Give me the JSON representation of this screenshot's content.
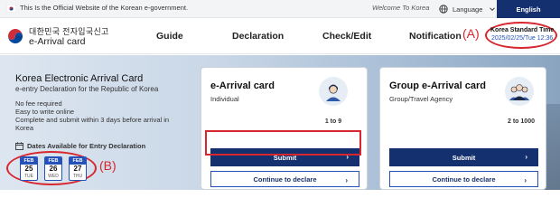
{
  "gov_bar": {
    "text": "This Is the Official Website of the Korean e-government.",
    "welcome": "Welcome To Korea",
    "language_label": "Language",
    "language_selected": "English"
  },
  "header": {
    "logo_ko": "대한민국 전자입국신고",
    "logo_en": "e-Arrival card",
    "nav": [
      "Guide",
      "Declaration",
      "Check/Edit",
      "Notification"
    ],
    "time_label": "Korea Standard Time",
    "time_value": "2025/02/25/Tue 12:36"
  },
  "annotations": {
    "a": "(A)",
    "b": "(B)"
  },
  "hero": {
    "title": "Korea Electronic Arrival Card",
    "subtitle": "e-entry Declaration for the Republic of Korea",
    "lines": [
      "No fee required",
      "Easy to write online",
      "Complete and submit within 3 days before arrival in",
      "Korea"
    ],
    "dates_heading": "Dates Available for Entry Declaration",
    "dates": [
      {
        "month": "FEB",
        "day": "25",
        "weekday": "TUE"
      },
      {
        "month": "FEB",
        "day": "26",
        "weekday": "WED"
      },
      {
        "month": "FEB",
        "day": "27",
        "weekday": "THU"
      }
    ]
  },
  "cards": [
    {
      "title": "e-Arrival card",
      "subtitle": "Individual",
      "count": "1 to 9",
      "icon": "person-icon",
      "submit_label": "Submit",
      "continue_label": "Continue to declare"
    },
    {
      "title": "Group e-Arrival card",
      "subtitle": "Group/Travel Agency",
      "count": "2 to 1000",
      "icon": "group-icon",
      "submit_label": "Submit",
      "continue_label": "Continue to declare"
    }
  ],
  "colors": {
    "primary": "#15306e",
    "accent_blue": "#2452b8",
    "annotation_red": "#d8262f"
  }
}
